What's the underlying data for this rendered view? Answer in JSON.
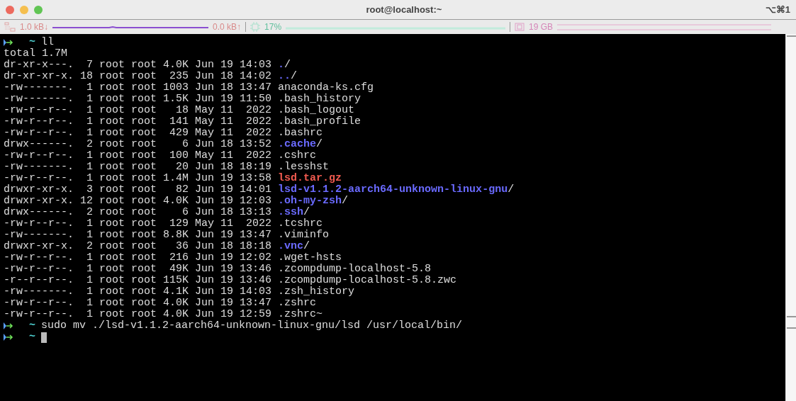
{
  "window": {
    "title": "root@localhost:~",
    "shortcut": "⌥⌘1"
  },
  "status_bar": {
    "network_down": "1.0 kB↓",
    "network_up": "0.0 kB↑",
    "cpu": "17%",
    "memory": "19 GB"
  },
  "terminal": {
    "lines": [
      {
        "kind": "prompt",
        "dir": "~",
        "command": "ll"
      },
      {
        "kind": "output",
        "text": "total 1.7M"
      },
      {
        "kind": "dir",
        "meta": "dr-xr-x---.  7 root root 4.0K Jun 19 14:03 ",
        "name": ".",
        "suffix": "/"
      },
      {
        "kind": "dir",
        "meta": "dr-xr-xr-x. 18 root root  235 Jun 18 14:02 ",
        "name": "..",
        "suffix": "/"
      },
      {
        "kind": "file",
        "meta": "-rw-------.  1 root root 1003 Jun 18 13:47 ",
        "name": "anaconda-ks.cfg"
      },
      {
        "kind": "file",
        "meta": "-rw-------.  1 root root 1.5K Jun 19 11:50 ",
        "name": ".bash_history"
      },
      {
        "kind": "file",
        "meta": "-rw-r--r--.  1 root root   18 May 11  2022 ",
        "name": ".bash_logout"
      },
      {
        "kind": "file",
        "meta": "-rw-r--r--.  1 root root  141 May 11  2022 ",
        "name": ".bash_profile"
      },
      {
        "kind": "file",
        "meta": "-rw-r--r--.  1 root root  429 May 11  2022 ",
        "name": ".bashrc"
      },
      {
        "kind": "dir",
        "meta": "drwx------.  2 root root    6 Jun 18 13:52 ",
        "name": ".cache",
        "suffix": "/"
      },
      {
        "kind": "file",
        "meta": "-rw-r--r--.  1 root root  100 May 11  2022 ",
        "name": ".cshrc"
      },
      {
        "kind": "file",
        "meta": "-rw-------.  1 root root   20 Jun 18 18:19 ",
        "name": ".lesshst"
      },
      {
        "kind": "archive",
        "meta": "-rw-r--r--.  1 root root 1.4M Jun 19 13:58 ",
        "name": "lsd.tar.gz"
      },
      {
        "kind": "dir",
        "meta": "drwxr-xr-x.  3 root root   82 Jun 19 14:01 ",
        "name": "lsd-v1.1.2-aarch64-unknown-linux-gnu",
        "suffix": "/"
      },
      {
        "kind": "dir",
        "meta": "drwxr-xr-x. 12 root root 4.0K Jun 19 12:03 ",
        "name": ".oh-my-zsh",
        "suffix": "/"
      },
      {
        "kind": "dir",
        "meta": "drwx------.  2 root root    6 Jun 18 13:13 ",
        "name": ".ssh",
        "suffix": "/"
      },
      {
        "kind": "file",
        "meta": "-rw-r--r--.  1 root root  129 May 11  2022 ",
        "name": ".tcshrc"
      },
      {
        "kind": "file",
        "meta": "-rw-------.  1 root root 8.8K Jun 19 13:47 ",
        "name": ".viminfo"
      },
      {
        "kind": "dir",
        "meta": "drwxr-xr-x.  2 root root   36 Jun 18 18:18 ",
        "name": ".vnc",
        "suffix": "/"
      },
      {
        "kind": "file",
        "meta": "-rw-r--r--.  1 root root  216 Jun 19 12:02 ",
        "name": ".wget-hsts"
      },
      {
        "kind": "file",
        "meta": "-rw-r--r--.  1 root root  49K Jun 19 13:46 ",
        "name": ".zcompdump-localhost-5.8"
      },
      {
        "kind": "file",
        "meta": "-r--r--r--.  1 root root 115K Jun 19 13:46 ",
        "name": ".zcompdump-localhost-5.8.zwc"
      },
      {
        "kind": "file",
        "meta": "-rw-------.  1 root root 4.1K Jun 19 14:03 ",
        "name": ".zsh_history"
      },
      {
        "kind": "file",
        "meta": "-rw-r--r--.  1 root root 4.0K Jun 19 13:47 ",
        "name": ".zshrc"
      },
      {
        "kind": "file",
        "meta": "-rw-r--r--.  1 root root 4.0K Jun 19 12:59 ",
        "name": ".zshrc~"
      },
      {
        "kind": "prompt",
        "dir": "~",
        "command": "sudo mv ./lsd-v1.1.2-aarch64-unknown-linux-gnu/lsd /usr/local/bin/"
      },
      {
        "kind": "prompt",
        "dir": "~",
        "cursor": true
      }
    ]
  }
}
